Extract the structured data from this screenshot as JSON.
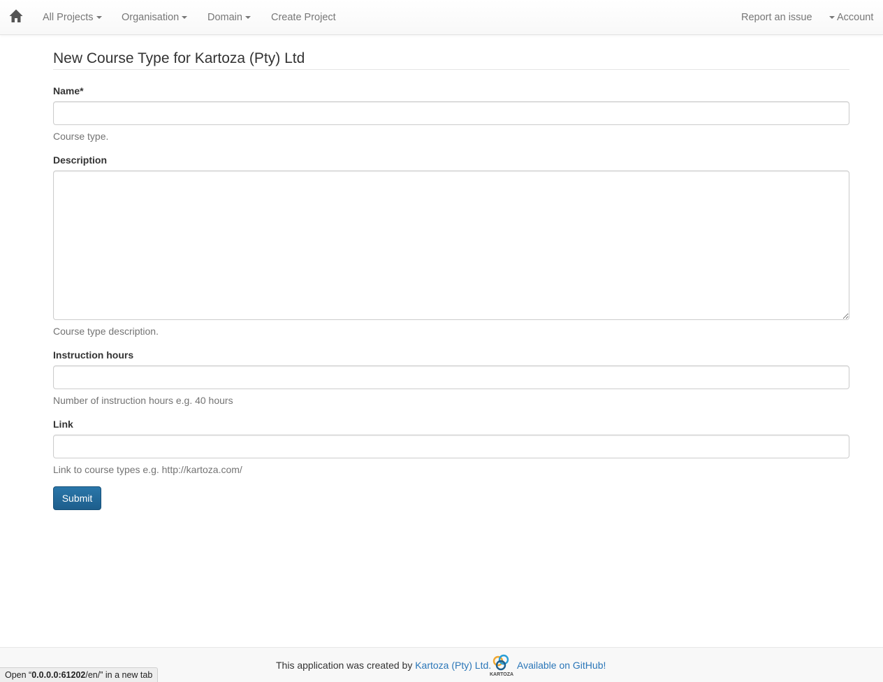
{
  "navbar": {
    "home_icon": "home-icon",
    "items": [
      {
        "label": "All Projects",
        "dropdown": true
      },
      {
        "label": "Organisation",
        "dropdown": true
      },
      {
        "label": "Domain",
        "dropdown": true
      },
      {
        "label": "Create Project",
        "dropdown": false
      }
    ],
    "report_issue": "Report an issue",
    "account": "Account"
  },
  "page": {
    "title": "New Course Type for Kartoza (Pty) Ltd"
  },
  "form": {
    "name": {
      "label": "Name*",
      "value": "",
      "help": "Course type."
    },
    "description": {
      "label": "Description",
      "value": "",
      "help": "Course type description."
    },
    "instruction_hours": {
      "label": "Instruction hours",
      "value": "",
      "help": "Number of instruction hours e.g. 40 hours"
    },
    "link": {
      "label": "Link",
      "value": "",
      "help": "Link to course types e.g. http://kartoza.com/"
    },
    "submit_label": "Submit"
  },
  "footer": {
    "text": "This application was created by",
    "company_link": "Kartoza (Pty) Ltd.",
    "logo_text": "KARTOZA",
    "github_link": "Available on GitHub!"
  },
  "status_bar": {
    "prefix": "Open “",
    "url": "0.0.0.0:61202",
    "path": "/en/",
    "suffix": "” in a new tab"
  },
  "colors": {
    "primary_button": "#1d5e8c",
    "link": "#2a76b8",
    "nav_text": "#777777"
  }
}
